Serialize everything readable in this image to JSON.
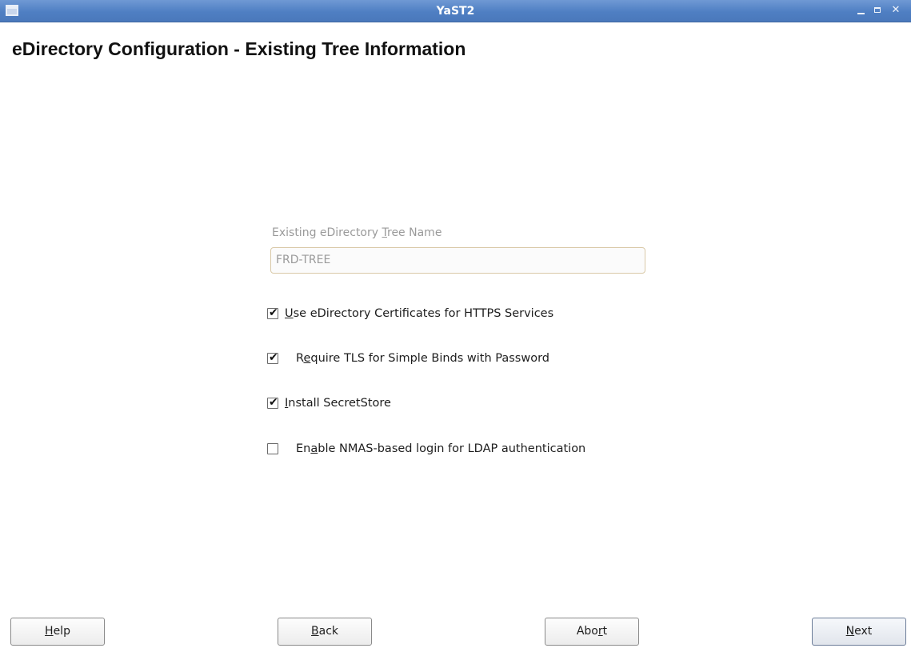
{
  "window": {
    "title": "YaST2",
    "controls": [
      "minimize-icon",
      "maximize-icon",
      "close-icon"
    ]
  },
  "page": {
    "heading": "eDirectory Configuration - Existing Tree Information"
  },
  "tree_name": {
    "label_before": "Existing eDirectory ",
    "label_mnemonic": "T",
    "label_after": "ree Name",
    "value": "FRD-TREE",
    "enabled": false
  },
  "options": [
    {
      "before": "",
      "mnemonic": "U",
      "after": "se eDirectory Certificates for HTTPS Services",
      "checked": true
    },
    {
      "before": "R",
      "mnemonic": "e",
      "after": "quire TLS for Simple Binds with Password",
      "checked": true
    },
    {
      "before": "",
      "mnemonic": "I",
      "after": "nstall SecretStore",
      "checked": true
    },
    {
      "before": "En",
      "mnemonic": "a",
      "after": "ble NMAS-based login for LDAP authentication",
      "checked": false
    }
  ],
  "buttons": {
    "help": {
      "before": "",
      "mnemonic": "H",
      "after": "elp"
    },
    "back": {
      "before": "",
      "mnemonic": "B",
      "after": "ack"
    },
    "abort": {
      "before": "Abo",
      "mnemonic": "r",
      "after": "t"
    },
    "next": {
      "before": "",
      "mnemonic": "N",
      "after": "ext"
    }
  },
  "check_glyph": "✔"
}
